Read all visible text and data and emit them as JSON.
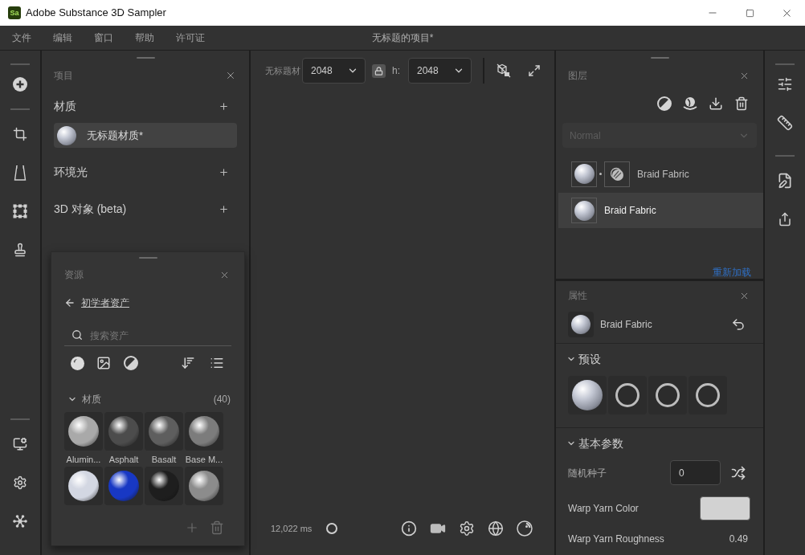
{
  "window": {
    "badge": "Sa",
    "title": "Adobe Substance 3D Sampler"
  },
  "menu": {
    "items": [
      "文件",
      "编辑",
      "窗口",
      "帮助",
      "许可证"
    ],
    "document_title": "无标题的项目*"
  },
  "project_panel": {
    "title": "项目",
    "sections": [
      {
        "label": "材质",
        "items": [
          {
            "label": "无标题材质*",
            "selected": true
          }
        ]
      },
      {
        "label": "环境光"
      },
      {
        "label": "3D 对象 (beta)"
      }
    ]
  },
  "assets_panel": {
    "title": "资源",
    "back_link": "初学者资产",
    "search": {
      "placeholder": "搜索资产"
    },
    "section": {
      "label": "材质",
      "count": "(40)",
      "expanded": true
    },
    "materials": [
      {
        "label": "Alumin...",
        "color": "#a9a9a9"
      },
      {
        "label": "Asphalt",
        "color": "#4c4c4c"
      },
      {
        "label": "Basalt",
        "color": "#5e5e5e"
      },
      {
        "label": "Base M...",
        "color": "#7c7c7c"
      },
      {
        "color": "#d3d7e2"
      },
      {
        "color": "#1838c4"
      },
      {
        "color": "#1e1e1e"
      },
      {
        "color": "#8c8c8c"
      }
    ]
  },
  "viewport": {
    "name_label": "无标题材",
    "width": {
      "value": "2048"
    },
    "locked": true,
    "height_label": "h:",
    "height": {
      "value": "2048"
    },
    "render_time": "12,022 ms"
  },
  "layers_panel": {
    "title": "图层",
    "blend_mode": {
      "value": "Normal",
      "disabled": true
    },
    "layers": [
      {
        "name": "Braid Fabric",
        "mask": true,
        "selected": false
      },
      {
        "name": "Braid Fabric",
        "mask": false,
        "selected": true
      }
    ],
    "reload_link": "重新加载"
  },
  "properties_panel": {
    "title": "属性",
    "material": "Braid Fabric",
    "presets_section": {
      "label": "预设",
      "expanded": true
    },
    "presets": [
      {
        "kind": "sphere"
      },
      {
        "kind": "loading"
      },
      {
        "kind": "loading"
      },
      {
        "kind": "loading"
      }
    ],
    "params_section": {
      "label": "基本参数",
      "expanded": true
    },
    "params": [
      {
        "kind": "number",
        "label": "随机种子",
        "value": "0"
      },
      {
        "kind": "color",
        "label": "Warp Yarn Color",
        "color": "#d2d2d2"
      },
      {
        "kind": "reading",
        "label": "Warp Yarn Roughness",
        "value": "0.49"
      }
    ]
  }
}
